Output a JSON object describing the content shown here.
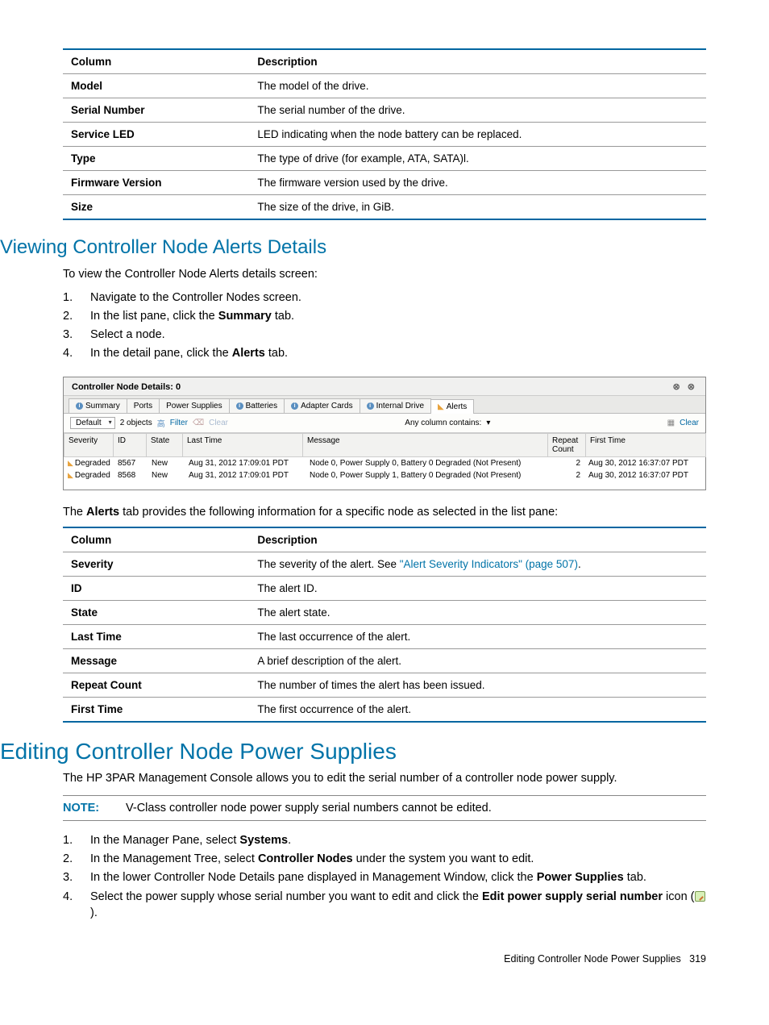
{
  "table1": {
    "head_col": "Column",
    "head_desc": "Description",
    "rows": [
      {
        "c": "Model",
        "d": "The model of the drive."
      },
      {
        "c": "Serial Number",
        "d": "The serial number of the drive."
      },
      {
        "c": "Service LED",
        "d": "LED indicating when the node battery can be replaced."
      },
      {
        "c": "Type",
        "d": "The type of drive (for example, ATA, SATA)l."
      },
      {
        "c": "Firmware Version",
        "d": "The firmware version used by the drive."
      },
      {
        "c": "Size",
        "d": "The size of the drive, in GiB."
      }
    ]
  },
  "sec1": {
    "title": "Viewing Controller Node Alerts Details",
    "intro": "To view the Controller Node Alerts details screen:",
    "steps": [
      {
        "n": "1.",
        "pre": "Navigate to the Controller Nodes screen."
      },
      {
        "n": "2.",
        "pre": "In the list pane, click the ",
        "b": "Summary",
        "post": " tab."
      },
      {
        "n": "3.",
        "pre": "Select a node."
      },
      {
        "n": "4.",
        "pre": "In the detail pane, click the ",
        "b": "Alerts",
        "post": " tab."
      }
    ]
  },
  "screenshot": {
    "title": "Controller Node Details: 0",
    "tabs": [
      "Summary",
      "Ports",
      "Power Supplies",
      "Batteries",
      "Adapter Cards",
      "Internal Drive",
      "Alerts"
    ],
    "toolbar": {
      "default": "Default",
      "count": "2 objects",
      "filter": "Filter",
      "clear": "Clear",
      "anycol": "Any column contains:",
      "clear2": "Clear"
    },
    "cols": [
      "Severity",
      "ID",
      "State",
      "Last Time",
      "Message",
      "Repeat Count",
      "First Time"
    ],
    "rows": [
      {
        "sev": "Degraded",
        "id": "8567",
        "state": "New",
        "last": "Aug 31, 2012 17:09:01 PDT",
        "msg": "Node 0, Power Supply 0, Battery 0 Degraded (Not Present)",
        "rep": "2",
        "first": "Aug 30, 2012 16:37:07 PDT"
      },
      {
        "sev": "Degraded",
        "id": "8568",
        "state": "New",
        "last": "Aug 31, 2012 17:09:01 PDT",
        "msg": "Node 0, Power Supply 1, Battery 0 Degraded (Not Present)",
        "rep": "2",
        "first": "Aug 30, 2012 16:37:07 PDT"
      }
    ]
  },
  "mid_para": {
    "pre": "The ",
    "b": "Alerts",
    "post": " tab provides the following information for a specific node as selected in the list pane:"
  },
  "table2": {
    "head_col": "Column",
    "head_desc": "Description",
    "rows": [
      {
        "c": "Severity",
        "d_pre": "The severity of the alert. See ",
        "link": "\"Alert Severity Indicators\" (page 507)",
        "d_post": "."
      },
      {
        "c": "ID",
        "d": "The alert ID."
      },
      {
        "c": "State",
        "d": "The alert state."
      },
      {
        "c": "Last Time",
        "d": "The last occurrence of the alert."
      },
      {
        "c": "Message",
        "d": "A brief description of the alert."
      },
      {
        "c": "Repeat Count",
        "d": "The number of times the alert has been issued."
      },
      {
        "c": "First Time",
        "d": "The first occurrence of the alert."
      }
    ]
  },
  "sec2": {
    "title": "Editing Controller Node Power Supplies",
    "intro": "The HP 3PAR Management Console allows you to edit the serial number of a controller node power supply.",
    "note_label": "NOTE:",
    "note_text": "V-Class controller node power supply serial numbers cannot be edited.",
    "steps": [
      {
        "n": "1.",
        "parts": [
          {
            "t": "In the Manager Pane, select "
          },
          {
            "b": "Systems"
          },
          {
            "t": "."
          }
        ]
      },
      {
        "n": "2.",
        "parts": [
          {
            "t": "In the Management Tree, select "
          },
          {
            "b": "Controller Nodes"
          },
          {
            "t": " under the system you want to edit."
          }
        ]
      },
      {
        "n": "3.",
        "parts": [
          {
            "t": "In the lower Controller Node Details pane displayed in Management Window, click the "
          },
          {
            "b": "Power Supplies"
          },
          {
            "t": " tab."
          }
        ]
      },
      {
        "n": "4.",
        "parts": [
          {
            "t": "Select the power supply whose serial number you want to edit and click the "
          },
          {
            "b": "Edit power supply serial number"
          },
          {
            "t": " icon ("
          },
          {
            "icon": true
          },
          {
            "t": ")."
          }
        ]
      }
    ]
  },
  "footer": {
    "text": "Editing Controller Node Power Supplies",
    "page": "319"
  }
}
